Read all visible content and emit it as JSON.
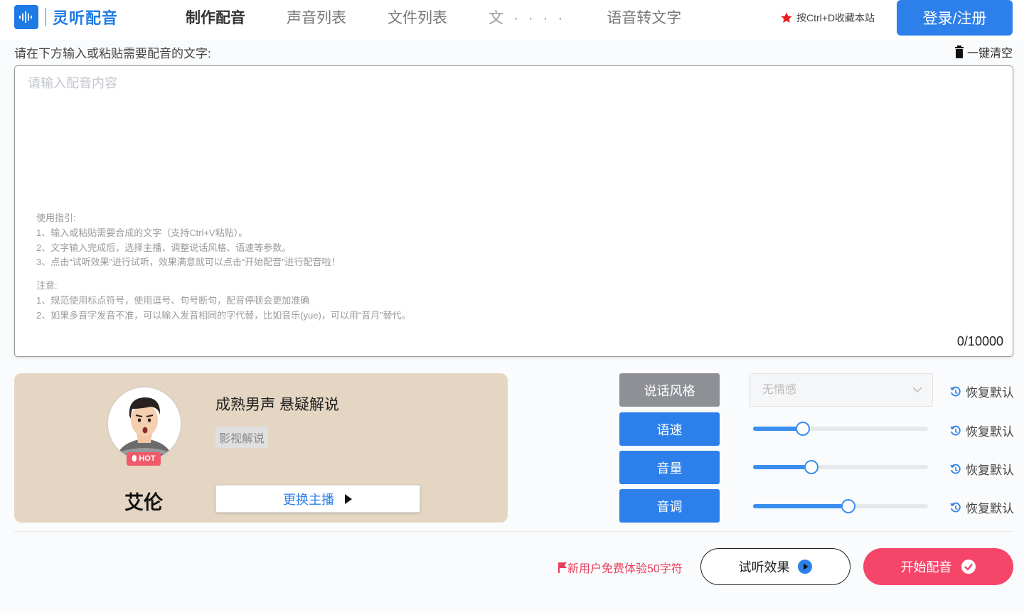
{
  "header": {
    "logo_text": "灵听配音",
    "nav": [
      {
        "label": "制作配音"
      },
      {
        "label": "声音列表"
      },
      {
        "label": "文件列表"
      },
      {
        "label": "文 · · · ·"
      },
      {
        "label": "语音转文字"
      }
    ],
    "favorite_text": "按Ctrl+D收藏本站",
    "login_label": "登录/注册"
  },
  "editor": {
    "prompt_label": "请在下方输入或粘贴需要配音的文字:",
    "clear_label": "一键清空",
    "placeholder": "请输入配音内容",
    "guide_title": "使用指引:",
    "guide_lines": [
      "1、输入或粘贴需要合成的文字（支持Ctrl+V粘贴）。",
      "2、文字输入完成后，选择主播，调整说话风格、语速等参数。",
      "3、点击“试听效果”进行试听，效果满意就可以点击“开始配音”进行配音啦！"
    ],
    "note_title": "注意:",
    "note_lines": [
      "1、规范使用标点符号，使用逗号、句号断句，配音停顿会更加准确",
      "2、如果多音字发音不准，可以输入发音相同的字代替，比如音乐(yue)，可以用“音月”替代。"
    ],
    "counter": "0/10000"
  },
  "voice": {
    "badge": "HOT",
    "name": "艾伦",
    "description": "成熟男声 悬疑解说",
    "tag": "影视解说",
    "change_label": "更换主播"
  },
  "controls": {
    "style_label": "说话风格",
    "style_value": "无情感",
    "speed_label": "语速",
    "volume_label": "音量",
    "pitch_label": "音调",
    "reset_label": "恢复默认",
    "speed_fraction": 0.285,
    "volume_fraction": 0.335,
    "pitch_fraction": 0.545
  },
  "footer": {
    "promo_text": "新用户免费体验50字符",
    "listen_label": "试听效果",
    "start_label": "开始配音"
  },
  "colors": {
    "primary": "#2d80ea",
    "accent": "#f5466a",
    "card": "#e5d6c3"
  }
}
